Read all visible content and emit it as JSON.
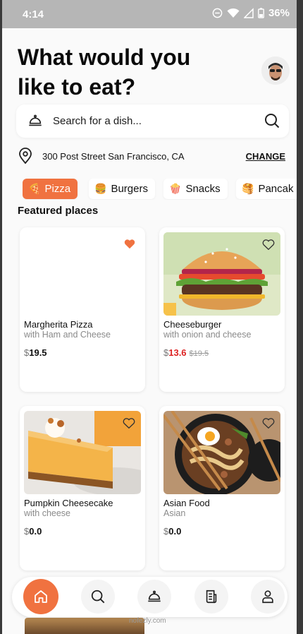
{
  "status_bar": {
    "time": "4:14",
    "battery": "36%"
  },
  "header": {
    "headline_line1": "What would you",
    "headline_line2": "like to eat?"
  },
  "search": {
    "placeholder": "Search for a dish..."
  },
  "location": {
    "address": "300 Post Street San Francisco, CA",
    "change_label": "CHANGE"
  },
  "categories": [
    {
      "label": "Pizza",
      "emoji": "🍕",
      "active": true
    },
    {
      "label": "Burgers",
      "emoji": "🍔",
      "active": false
    },
    {
      "label": "Snacks",
      "emoji": "🍿",
      "active": false
    },
    {
      "label": "Pancak",
      "emoji": "🥞",
      "active": false
    }
  ],
  "featured": {
    "title": "Featured places",
    "items": [
      {
        "name": "Margherita Pizza",
        "description": "with Ham and Cheese",
        "currency": "$",
        "price": "19.5",
        "old_price": "",
        "favorite": true
      },
      {
        "name": "Cheeseburger",
        "description": "with onion and cheese",
        "currency": "$",
        "price": "13.6",
        "old_price": "$19.5",
        "favorite": false
      },
      {
        "name": "Pumpkin Cheesecake",
        "description": "with cheese",
        "currency": "$",
        "price": "0.0",
        "old_price": "",
        "favorite": false
      },
      {
        "name": "Asian Food",
        "description": "Asian",
        "currency": "$",
        "price": "0.0",
        "old_price": "",
        "favorite": false
      }
    ]
  },
  "bottom_nav": [
    {
      "icon": "home-icon",
      "active": true
    },
    {
      "icon": "search-icon",
      "active": false
    },
    {
      "icon": "cloche-icon",
      "active": false
    },
    {
      "icon": "orders-icon",
      "active": false
    },
    {
      "icon": "profile-icon",
      "active": false
    }
  ],
  "watermark": "nofezly.com",
  "colors": {
    "accent": "#f07240",
    "sale": "#dd2222",
    "muted": "#8a8a8a"
  }
}
